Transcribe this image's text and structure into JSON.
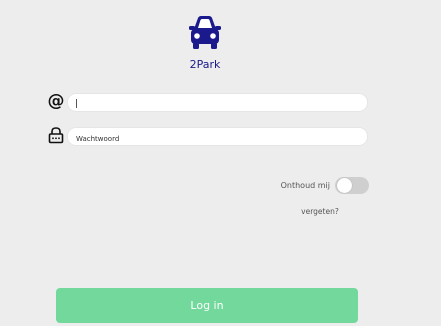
{
  "app": {
    "name": "2Park",
    "logo_icon": "car-front-icon",
    "brand_color": "#1a1a8c"
  },
  "form": {
    "email": {
      "icon": "at-sign-icon",
      "icon_text": "@",
      "value": "",
      "placeholder": ""
    },
    "password": {
      "icon": "lock-icon",
      "value": "",
      "placeholder": "Wachtwoord"
    },
    "remember": {
      "label": "Onthoud mij",
      "checked": false
    },
    "forgot_label": "vergeten?",
    "login_label": "Log in",
    "login_color": "#72d89b"
  }
}
